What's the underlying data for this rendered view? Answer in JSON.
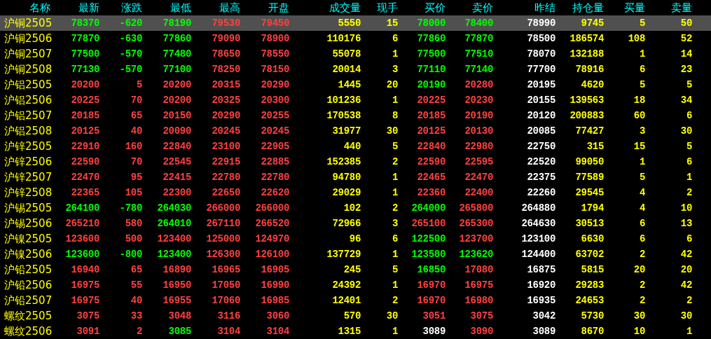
{
  "columns": [
    {
      "label": "名称",
      "kind": "name"
    },
    {
      "label": "最新",
      "kind": "price"
    },
    {
      "label": "涨跌",
      "kind": "price"
    },
    {
      "label": "最低",
      "kind": "price"
    },
    {
      "label": "最高",
      "kind": "price"
    },
    {
      "label": "开盘",
      "kind": "price"
    },
    {
      "label": "成交量",
      "kind": "volume"
    },
    {
      "label": "现手",
      "kind": "volume"
    },
    {
      "label": "买价",
      "kind": "price"
    },
    {
      "label": "卖价",
      "kind": "price"
    },
    {
      "label": "昨结",
      "kind": "settle"
    },
    {
      "label": "持仓量",
      "kind": "volume"
    },
    {
      "label": "买量",
      "kind": "volume"
    },
    {
      "label": "卖量",
      "kind": "volume"
    }
  ],
  "rows": [
    {
      "selected": true,
      "cells": [
        "沪铜2505",
        {
          "text": "78370",
          "color": "#00ff00"
        },
        {
          "text": "-620",
          "color": "#00ff00"
        },
        {
          "text": "78190",
          "color": "#00ff00"
        },
        {
          "text": "79530",
          "color": "#ff4040"
        },
        {
          "text": "79450",
          "color": "#ff4040"
        },
        "5550",
        "15",
        {
          "text": "78000",
          "color": "#00ff00"
        },
        {
          "text": "78400",
          "color": "#00ff00"
        },
        "78990",
        "9745",
        "5",
        "50"
      ]
    },
    {
      "selected": false,
      "cells": [
        "沪铜2506",
        {
          "text": "77870",
          "color": "#00ff00"
        },
        {
          "text": "-630",
          "color": "#00ff00"
        },
        {
          "text": "77860",
          "color": "#00ff00"
        },
        {
          "text": "79090",
          "color": "#ff4040"
        },
        {
          "text": "78900",
          "color": "#ff4040"
        },
        "110176",
        "6",
        {
          "text": "77860",
          "color": "#00ff00"
        },
        {
          "text": "77870",
          "color": "#00ff00"
        },
        "78500",
        "186574",
        "108",
        "52"
      ]
    },
    {
      "selected": false,
      "cells": [
        "沪铜2507",
        {
          "text": "77500",
          "color": "#00ff00"
        },
        {
          "text": "-570",
          "color": "#00ff00"
        },
        {
          "text": "77480",
          "color": "#00ff00"
        },
        {
          "text": "78650",
          "color": "#ff4040"
        },
        {
          "text": "78550",
          "color": "#ff4040"
        },
        "55078",
        "1",
        {
          "text": "77500",
          "color": "#00ff00"
        },
        {
          "text": "77510",
          "color": "#00ff00"
        },
        "78070",
        "132188",
        "1",
        "14"
      ]
    },
    {
      "selected": false,
      "cells": [
        "沪铜2508",
        {
          "text": "77130",
          "color": "#00ff00"
        },
        {
          "text": "-570",
          "color": "#00ff00"
        },
        {
          "text": "77100",
          "color": "#00ff00"
        },
        {
          "text": "78250",
          "color": "#ff4040"
        },
        {
          "text": "78150",
          "color": "#ff4040"
        },
        "20014",
        "3",
        {
          "text": "77110",
          "color": "#00ff00"
        },
        {
          "text": "77140",
          "color": "#00ff00"
        },
        "77700",
        "78916",
        "6",
        "23"
      ]
    },
    {
      "selected": false,
      "cells": [
        "沪铝2505",
        {
          "text": "20200",
          "color": "#ff4040"
        },
        {
          "text": "5",
          "color": "#ff4040"
        },
        {
          "text": "20200",
          "color": "#ff4040"
        },
        {
          "text": "20315",
          "color": "#ff4040"
        },
        {
          "text": "20290",
          "color": "#ff4040"
        },
        "1445",
        "20",
        {
          "text": "20190",
          "color": "#00ff00"
        },
        {
          "text": "20280",
          "color": "#ff4040"
        },
        "20195",
        "4620",
        "5",
        "5"
      ]
    },
    {
      "selected": false,
      "cells": [
        "沪铝2506",
        {
          "text": "20225",
          "color": "#ff4040"
        },
        {
          "text": "70",
          "color": "#ff4040"
        },
        {
          "text": "20200",
          "color": "#ff4040"
        },
        {
          "text": "20325",
          "color": "#ff4040"
        },
        {
          "text": "20300",
          "color": "#ff4040"
        },
        "101236",
        "1",
        {
          "text": "20225",
          "color": "#ff4040"
        },
        {
          "text": "20230",
          "color": "#ff4040"
        },
        "20155",
        "139563",
        "18",
        "34"
      ]
    },
    {
      "selected": false,
      "cells": [
        "沪铝2507",
        {
          "text": "20185",
          "color": "#ff4040"
        },
        {
          "text": "65",
          "color": "#ff4040"
        },
        {
          "text": "20150",
          "color": "#ff4040"
        },
        {
          "text": "20290",
          "color": "#ff4040"
        },
        {
          "text": "20255",
          "color": "#ff4040"
        },
        "170538",
        "8",
        {
          "text": "20185",
          "color": "#ff4040"
        },
        {
          "text": "20190",
          "color": "#ff4040"
        },
        "20120",
        "200883",
        "60",
        "6"
      ]
    },
    {
      "selected": false,
      "cells": [
        "沪铝2508",
        {
          "text": "20125",
          "color": "#ff4040"
        },
        {
          "text": "40",
          "color": "#ff4040"
        },
        {
          "text": "20090",
          "color": "#ff4040"
        },
        {
          "text": "20245",
          "color": "#ff4040"
        },
        {
          "text": "20245",
          "color": "#ff4040"
        },
        "31977",
        "30",
        {
          "text": "20125",
          "color": "#ff4040"
        },
        {
          "text": "20130",
          "color": "#ff4040"
        },
        "20085",
        "77427",
        "3",
        "30"
      ]
    },
    {
      "selected": false,
      "cells": [
        "沪锌2505",
        {
          "text": "22910",
          "color": "#ff4040"
        },
        {
          "text": "160",
          "color": "#ff4040"
        },
        {
          "text": "22840",
          "color": "#ff4040"
        },
        {
          "text": "23100",
          "color": "#ff4040"
        },
        {
          "text": "22905",
          "color": "#ff4040"
        },
        "440",
        "5",
        {
          "text": "22840",
          "color": "#ff4040"
        },
        {
          "text": "22980",
          "color": "#ff4040"
        },
        "22750",
        "315",
        "15",
        "5"
      ]
    },
    {
      "selected": false,
      "cells": [
        "沪锌2506",
        {
          "text": "22590",
          "color": "#ff4040"
        },
        {
          "text": "70",
          "color": "#ff4040"
        },
        {
          "text": "22545",
          "color": "#ff4040"
        },
        {
          "text": "22915",
          "color": "#ff4040"
        },
        {
          "text": "22885",
          "color": "#ff4040"
        },
        "152385",
        "2",
        {
          "text": "22590",
          "color": "#ff4040"
        },
        {
          "text": "22595",
          "color": "#ff4040"
        },
        "22520",
        "99050",
        "1",
        "6"
      ]
    },
    {
      "selected": false,
      "cells": [
        "沪锌2507",
        {
          "text": "22470",
          "color": "#ff4040"
        },
        {
          "text": "95",
          "color": "#ff4040"
        },
        {
          "text": "22415",
          "color": "#ff4040"
        },
        {
          "text": "22780",
          "color": "#ff4040"
        },
        {
          "text": "22780",
          "color": "#ff4040"
        },
        "94780",
        "1",
        {
          "text": "22465",
          "color": "#ff4040"
        },
        {
          "text": "22470",
          "color": "#ff4040"
        },
        "22375",
        "77589",
        "5",
        "1"
      ]
    },
    {
      "selected": false,
      "cells": [
        "沪锌2508",
        {
          "text": "22365",
          "color": "#ff4040"
        },
        {
          "text": "105",
          "color": "#ff4040"
        },
        {
          "text": "22300",
          "color": "#ff4040"
        },
        {
          "text": "22650",
          "color": "#ff4040"
        },
        {
          "text": "22620",
          "color": "#ff4040"
        },
        "29029",
        "1",
        {
          "text": "22360",
          "color": "#ff4040"
        },
        {
          "text": "22400",
          "color": "#ff4040"
        },
        "22260",
        "29545",
        "4",
        "2"
      ]
    },
    {
      "selected": false,
      "cells": [
        "沪锡2505",
        {
          "text": "264100",
          "color": "#00ff00"
        },
        {
          "text": "-780",
          "color": "#00ff00"
        },
        {
          "text": "264030",
          "color": "#00ff00"
        },
        {
          "text": "266000",
          "color": "#ff4040"
        },
        {
          "text": "266000",
          "color": "#ff4040"
        },
        "102",
        "2",
        {
          "text": "264000",
          "color": "#00ff00"
        },
        {
          "text": "265800",
          "color": "#ff4040"
        },
        "264880",
        "1794",
        "4",
        "10"
      ]
    },
    {
      "selected": false,
      "cells": [
        "沪锡2506",
        {
          "text": "265210",
          "color": "#ff4040"
        },
        {
          "text": "580",
          "color": "#ff4040"
        },
        {
          "text": "264010",
          "color": "#00ff00"
        },
        {
          "text": "267110",
          "color": "#ff4040"
        },
        {
          "text": "266520",
          "color": "#ff4040"
        },
        "72966",
        "3",
        {
          "text": "265100",
          "color": "#ff4040"
        },
        {
          "text": "265300",
          "color": "#ff4040"
        },
        "264630",
        "30513",
        "6",
        "13"
      ]
    },
    {
      "selected": false,
      "cells": [
        "沪镍2505",
        {
          "text": "123600",
          "color": "#ff4040"
        },
        {
          "text": "500",
          "color": "#ff4040"
        },
        {
          "text": "123400",
          "color": "#ff4040"
        },
        {
          "text": "125000",
          "color": "#ff4040"
        },
        {
          "text": "124970",
          "color": "#ff4040"
        },
        "96",
        "6",
        {
          "text": "122500",
          "color": "#00ff00"
        },
        {
          "text": "123700",
          "color": "#ff4040"
        },
        "123100",
        "6630",
        "6",
        "6"
      ]
    },
    {
      "selected": false,
      "cells": [
        "沪镍2506",
        {
          "text": "123600",
          "color": "#00ff00"
        },
        {
          "text": "-800",
          "color": "#00ff00"
        },
        {
          "text": "123400",
          "color": "#00ff00"
        },
        {
          "text": "126300",
          "color": "#ff4040"
        },
        {
          "text": "126100",
          "color": "#ff4040"
        },
        "137729",
        "1",
        {
          "text": "123580",
          "color": "#00ff00"
        },
        {
          "text": "123620",
          "color": "#00ff00"
        },
        "124400",
        "63702",
        "2",
        "42"
      ]
    },
    {
      "selected": false,
      "cells": [
        "沪铅2505",
        {
          "text": "16940",
          "color": "#ff4040"
        },
        {
          "text": "65",
          "color": "#ff4040"
        },
        {
          "text": "16890",
          "color": "#ff4040"
        },
        {
          "text": "16965",
          "color": "#ff4040"
        },
        {
          "text": "16905",
          "color": "#ff4040"
        },
        "245",
        "5",
        {
          "text": "16850",
          "color": "#00ff00"
        },
        {
          "text": "17080",
          "color": "#ff4040"
        },
        "16875",
        "5815",
        "20",
        "20"
      ]
    },
    {
      "selected": false,
      "cells": [
        "沪铅2506",
        {
          "text": "16975",
          "color": "#ff4040"
        },
        {
          "text": "55",
          "color": "#ff4040"
        },
        {
          "text": "16950",
          "color": "#ff4040"
        },
        {
          "text": "17050",
          "color": "#ff4040"
        },
        {
          "text": "16990",
          "color": "#ff4040"
        },
        "24392",
        "1",
        {
          "text": "16970",
          "color": "#ff4040"
        },
        {
          "text": "16975",
          "color": "#ff4040"
        },
        "16920",
        "29283",
        "2",
        "42"
      ]
    },
    {
      "selected": false,
      "cells": [
        "沪铅2507",
        {
          "text": "16975",
          "color": "#ff4040"
        },
        {
          "text": "40",
          "color": "#ff4040"
        },
        {
          "text": "16955",
          "color": "#ff4040"
        },
        {
          "text": "17060",
          "color": "#ff4040"
        },
        {
          "text": "16985",
          "color": "#ff4040"
        },
        "12401",
        "2",
        {
          "text": "16970",
          "color": "#ff4040"
        },
        {
          "text": "16980",
          "color": "#ff4040"
        },
        "16935",
        "24653",
        "2",
        "2"
      ]
    },
    {
      "selected": false,
      "cells": [
        "螺纹2505",
        {
          "text": "3075",
          "color": "#ff4040"
        },
        {
          "text": "33",
          "color": "#ff4040"
        },
        {
          "text": "3048",
          "color": "#ff4040"
        },
        {
          "text": "3116",
          "color": "#ff4040"
        },
        {
          "text": "3060",
          "color": "#ff4040"
        },
        "570",
        "30",
        {
          "text": "3051",
          "color": "#ff4040"
        },
        {
          "text": "3075",
          "color": "#ff4040"
        },
        "3042",
        "5730",
        "30",
        "30"
      ]
    },
    {
      "selected": false,
      "cells": [
        "螺纹2506",
        {
          "text": "3091",
          "color": "#ff4040"
        },
        {
          "text": "2",
          "color": "#ff4040"
        },
        {
          "text": "3085",
          "color": "#00ff00"
        },
        {
          "text": "3104",
          "color": "#ff4040"
        },
        {
          "text": "3104",
          "color": "#ff4040"
        },
        "1315",
        "1",
        {
          "text": "3089",
          "color": "#ffffff"
        },
        {
          "text": "3090",
          "color": "#ff4040"
        },
        "3089",
        "8670",
        "10",
        "1"
      ]
    }
  ]
}
